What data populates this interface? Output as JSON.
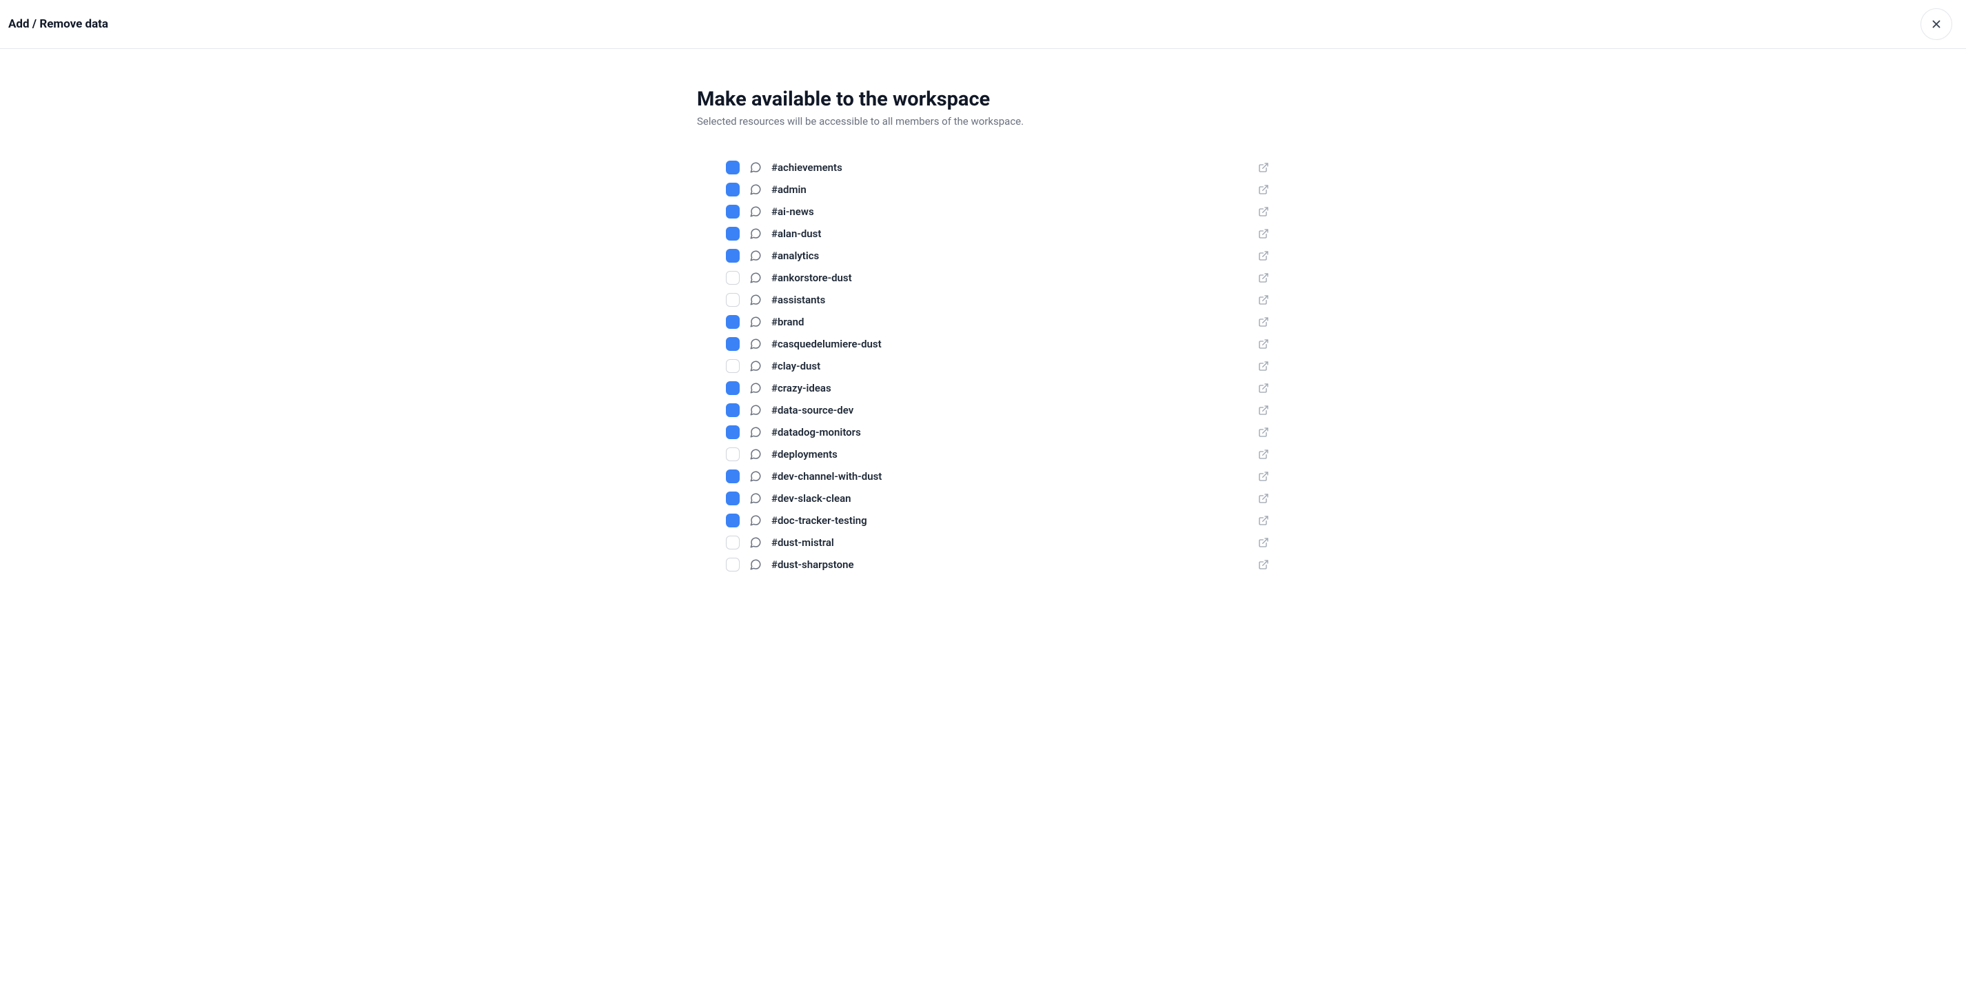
{
  "header": {
    "title": "Add / Remove data"
  },
  "main": {
    "title": "Make available to the workspace",
    "subtitle": "Selected resources will be accessible to all members of the workspace."
  },
  "channels": [
    {
      "name": "#achievements",
      "checked": true
    },
    {
      "name": "#admin",
      "checked": true
    },
    {
      "name": "#ai-news",
      "checked": true
    },
    {
      "name": "#alan-dust",
      "checked": true
    },
    {
      "name": "#analytics",
      "checked": true
    },
    {
      "name": "#ankorstore-dust",
      "checked": false
    },
    {
      "name": "#assistants",
      "checked": false
    },
    {
      "name": "#brand",
      "checked": true
    },
    {
      "name": "#casquedelumiere-dust",
      "checked": true
    },
    {
      "name": "#clay-dust",
      "checked": false
    },
    {
      "name": "#crazy-ideas",
      "checked": true
    },
    {
      "name": "#data-source-dev",
      "checked": true
    },
    {
      "name": "#datadog-monitors",
      "checked": true
    },
    {
      "name": "#deployments",
      "checked": false
    },
    {
      "name": "#dev-channel-with-dust",
      "checked": true
    },
    {
      "name": "#dev-slack-clean",
      "checked": true
    },
    {
      "name": "#doc-tracker-testing",
      "checked": true
    },
    {
      "name": "#dust-mistral",
      "checked": false
    },
    {
      "name": "#dust-sharpstone",
      "checked": false
    }
  ]
}
